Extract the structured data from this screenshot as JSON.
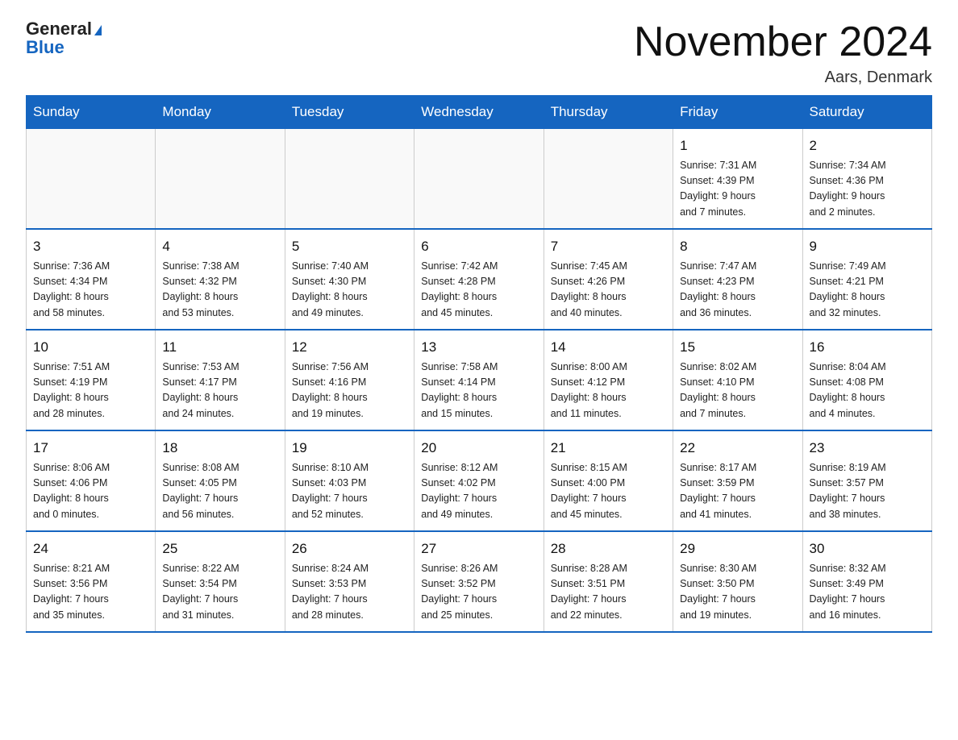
{
  "header": {
    "logo_line1": "General",
    "logo_line2": "Blue",
    "month_year": "November 2024",
    "location": "Aars, Denmark"
  },
  "weekdays": [
    "Sunday",
    "Monday",
    "Tuesday",
    "Wednesday",
    "Thursday",
    "Friday",
    "Saturday"
  ],
  "weeks": [
    [
      {
        "day": "",
        "info": ""
      },
      {
        "day": "",
        "info": ""
      },
      {
        "day": "",
        "info": ""
      },
      {
        "day": "",
        "info": ""
      },
      {
        "day": "",
        "info": ""
      },
      {
        "day": "1",
        "info": "Sunrise: 7:31 AM\nSunset: 4:39 PM\nDaylight: 9 hours\nand 7 minutes."
      },
      {
        "day": "2",
        "info": "Sunrise: 7:34 AM\nSunset: 4:36 PM\nDaylight: 9 hours\nand 2 minutes."
      }
    ],
    [
      {
        "day": "3",
        "info": "Sunrise: 7:36 AM\nSunset: 4:34 PM\nDaylight: 8 hours\nand 58 minutes."
      },
      {
        "day": "4",
        "info": "Sunrise: 7:38 AM\nSunset: 4:32 PM\nDaylight: 8 hours\nand 53 minutes."
      },
      {
        "day": "5",
        "info": "Sunrise: 7:40 AM\nSunset: 4:30 PM\nDaylight: 8 hours\nand 49 minutes."
      },
      {
        "day": "6",
        "info": "Sunrise: 7:42 AM\nSunset: 4:28 PM\nDaylight: 8 hours\nand 45 minutes."
      },
      {
        "day": "7",
        "info": "Sunrise: 7:45 AM\nSunset: 4:26 PM\nDaylight: 8 hours\nand 40 minutes."
      },
      {
        "day": "8",
        "info": "Sunrise: 7:47 AM\nSunset: 4:23 PM\nDaylight: 8 hours\nand 36 minutes."
      },
      {
        "day": "9",
        "info": "Sunrise: 7:49 AM\nSunset: 4:21 PM\nDaylight: 8 hours\nand 32 minutes."
      }
    ],
    [
      {
        "day": "10",
        "info": "Sunrise: 7:51 AM\nSunset: 4:19 PM\nDaylight: 8 hours\nand 28 minutes."
      },
      {
        "day": "11",
        "info": "Sunrise: 7:53 AM\nSunset: 4:17 PM\nDaylight: 8 hours\nand 24 minutes."
      },
      {
        "day": "12",
        "info": "Sunrise: 7:56 AM\nSunset: 4:16 PM\nDaylight: 8 hours\nand 19 minutes."
      },
      {
        "day": "13",
        "info": "Sunrise: 7:58 AM\nSunset: 4:14 PM\nDaylight: 8 hours\nand 15 minutes."
      },
      {
        "day": "14",
        "info": "Sunrise: 8:00 AM\nSunset: 4:12 PM\nDaylight: 8 hours\nand 11 minutes."
      },
      {
        "day": "15",
        "info": "Sunrise: 8:02 AM\nSunset: 4:10 PM\nDaylight: 8 hours\nand 7 minutes."
      },
      {
        "day": "16",
        "info": "Sunrise: 8:04 AM\nSunset: 4:08 PM\nDaylight: 8 hours\nand 4 minutes."
      }
    ],
    [
      {
        "day": "17",
        "info": "Sunrise: 8:06 AM\nSunset: 4:06 PM\nDaylight: 8 hours\nand 0 minutes."
      },
      {
        "day": "18",
        "info": "Sunrise: 8:08 AM\nSunset: 4:05 PM\nDaylight: 7 hours\nand 56 minutes."
      },
      {
        "day": "19",
        "info": "Sunrise: 8:10 AM\nSunset: 4:03 PM\nDaylight: 7 hours\nand 52 minutes."
      },
      {
        "day": "20",
        "info": "Sunrise: 8:12 AM\nSunset: 4:02 PM\nDaylight: 7 hours\nand 49 minutes."
      },
      {
        "day": "21",
        "info": "Sunrise: 8:15 AM\nSunset: 4:00 PM\nDaylight: 7 hours\nand 45 minutes."
      },
      {
        "day": "22",
        "info": "Sunrise: 8:17 AM\nSunset: 3:59 PM\nDaylight: 7 hours\nand 41 minutes."
      },
      {
        "day": "23",
        "info": "Sunrise: 8:19 AM\nSunset: 3:57 PM\nDaylight: 7 hours\nand 38 minutes."
      }
    ],
    [
      {
        "day": "24",
        "info": "Sunrise: 8:21 AM\nSunset: 3:56 PM\nDaylight: 7 hours\nand 35 minutes."
      },
      {
        "day": "25",
        "info": "Sunrise: 8:22 AM\nSunset: 3:54 PM\nDaylight: 7 hours\nand 31 minutes."
      },
      {
        "day": "26",
        "info": "Sunrise: 8:24 AM\nSunset: 3:53 PM\nDaylight: 7 hours\nand 28 minutes."
      },
      {
        "day": "27",
        "info": "Sunrise: 8:26 AM\nSunset: 3:52 PM\nDaylight: 7 hours\nand 25 minutes."
      },
      {
        "day": "28",
        "info": "Sunrise: 8:28 AM\nSunset: 3:51 PM\nDaylight: 7 hours\nand 22 minutes."
      },
      {
        "day": "29",
        "info": "Sunrise: 8:30 AM\nSunset: 3:50 PM\nDaylight: 7 hours\nand 19 minutes."
      },
      {
        "day": "30",
        "info": "Sunrise: 8:32 AM\nSunset: 3:49 PM\nDaylight: 7 hours\nand 16 minutes."
      }
    ]
  ]
}
